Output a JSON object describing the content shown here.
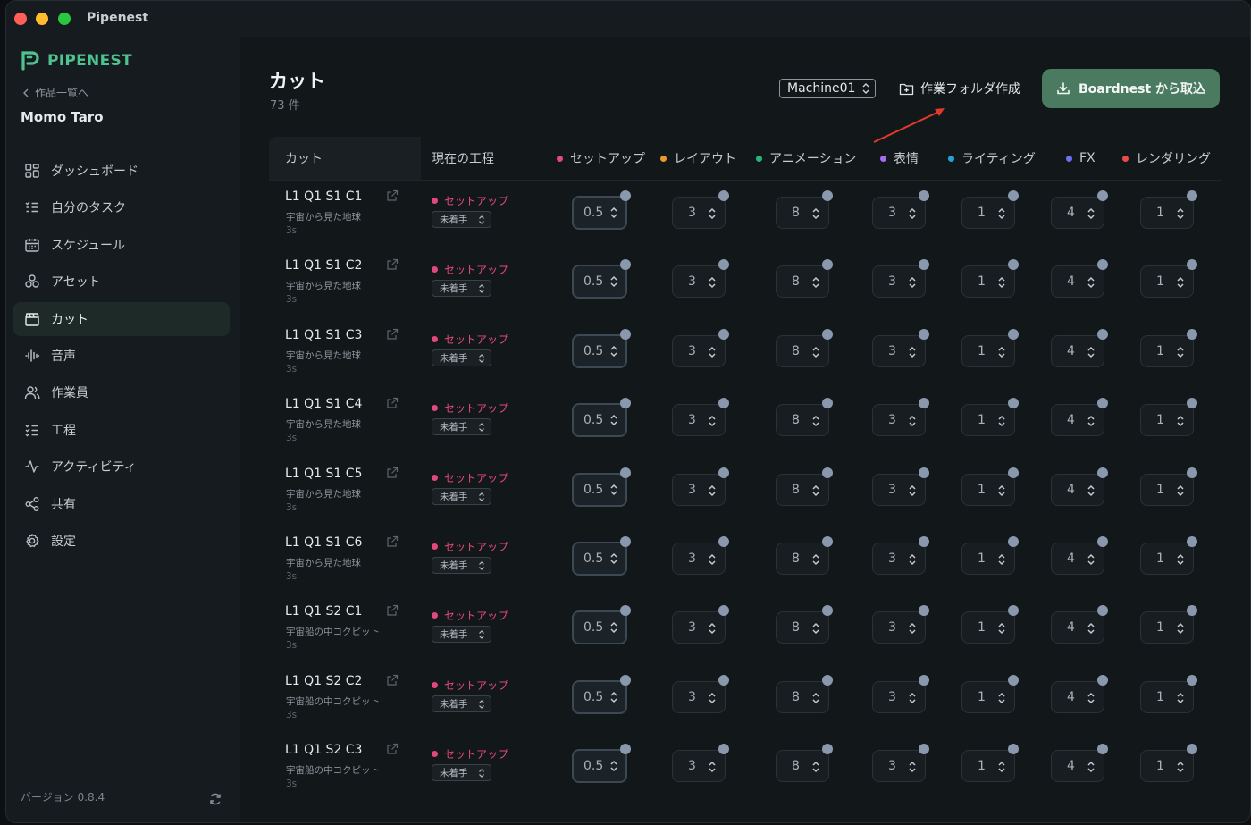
{
  "app": {
    "window_title": "Pipenest"
  },
  "sidebar": {
    "logo_text": "PIPENEST",
    "back_label": "作品一覧へ",
    "project_name": "Momo Taro",
    "items": [
      {
        "label": "ダッシュボード",
        "icon": "dashboard-icon",
        "active": false
      },
      {
        "label": "自分のタスク",
        "icon": "task-list-icon",
        "active": false
      },
      {
        "label": "スケジュール",
        "icon": "calendar-icon",
        "active": false
      },
      {
        "label": "アセット",
        "icon": "shapes-icon",
        "active": false
      },
      {
        "label": "カット",
        "icon": "clapperboard-icon",
        "active": true
      },
      {
        "label": "音声",
        "icon": "audio-waveform-icon",
        "active": false
      },
      {
        "label": "作業員",
        "icon": "users-icon",
        "active": false
      },
      {
        "label": "工程",
        "icon": "checklist-icon",
        "active": false
      },
      {
        "label": "アクティビティ",
        "icon": "activity-icon",
        "active": false
      },
      {
        "label": "共有",
        "icon": "share-icon",
        "active": false
      },
      {
        "label": "設定",
        "icon": "gear-icon",
        "active": false
      }
    ],
    "version": "バージョン 0.8.4"
  },
  "header": {
    "title": "カット",
    "count": "73 件",
    "machine_select": "Machine01",
    "folder_button": "作業フォルダ作成",
    "import_button": "Boardnest から取込"
  },
  "table": {
    "col_cut": "カット",
    "col_stage": "現在の工程",
    "processes": [
      {
        "label": "セットアップ",
        "color": "#e2497a"
      },
      {
        "label": "レイアウト",
        "color": "#e89a2c"
      },
      {
        "label": "アニメーション",
        "color": "#27b57a"
      },
      {
        "label": "表情",
        "color": "#a66bf0"
      },
      {
        "label": "ライティング",
        "color": "#24a3d6"
      },
      {
        "label": "FX",
        "color": "#6b72f0"
      },
      {
        "label": "レンダリング",
        "color": "#ec4b4b"
      }
    ],
    "rows": [
      {
        "name": "L1 Q1 S1 C1",
        "desc": "宇宙から見た地球",
        "duration": "3s",
        "stage": "セットアップ",
        "status": "未着手",
        "values": [
          "0.5",
          "3",
          "8",
          "3",
          "1",
          "4",
          "1"
        ]
      },
      {
        "name": "L1 Q1 S1 C2",
        "desc": "宇宙から見た地球",
        "duration": "3s",
        "stage": "セットアップ",
        "status": "未着手",
        "values": [
          "0.5",
          "3",
          "8",
          "3",
          "1",
          "4",
          "1"
        ]
      },
      {
        "name": "L1 Q1 S1 C3",
        "desc": "宇宙から見た地球",
        "duration": "3s",
        "stage": "セットアップ",
        "status": "未着手",
        "values": [
          "0.5",
          "3",
          "8",
          "3",
          "1",
          "4",
          "1"
        ]
      },
      {
        "name": "L1 Q1 S1 C4",
        "desc": "宇宙から見た地球",
        "duration": "3s",
        "stage": "セットアップ",
        "status": "未着手",
        "values": [
          "0.5",
          "3",
          "8",
          "3",
          "1",
          "4",
          "1"
        ]
      },
      {
        "name": "L1 Q1 S1 C5",
        "desc": "宇宙から見た地球",
        "duration": "3s",
        "stage": "セットアップ",
        "status": "未着手",
        "values": [
          "0.5",
          "3",
          "8",
          "3",
          "1",
          "4",
          "1"
        ]
      },
      {
        "name": "L1 Q1 S1 C6",
        "desc": "宇宙から見た地球",
        "duration": "3s",
        "stage": "セットアップ",
        "status": "未着手",
        "values": [
          "0.5",
          "3",
          "8",
          "3",
          "1",
          "4",
          "1"
        ]
      },
      {
        "name": "L1 Q1 S2 C1",
        "desc": "宇宙船の中コクピット",
        "duration": "3s",
        "stage": "セットアップ",
        "status": "未着手",
        "values": [
          "0.5",
          "3",
          "8",
          "3",
          "1",
          "4",
          "1"
        ]
      },
      {
        "name": "L1 Q1 S2 C2",
        "desc": "宇宙船の中コクピット",
        "duration": "3s",
        "stage": "セットアップ",
        "status": "未着手",
        "values": [
          "0.5",
          "3",
          "8",
          "3",
          "1",
          "4",
          "1"
        ]
      },
      {
        "name": "L1 Q1 S2 C3",
        "desc": "宇宙船の中コクピット",
        "duration": "3s",
        "stage": "セットアップ",
        "status": "未着手",
        "values": [
          "0.5",
          "3",
          "8",
          "3",
          "1",
          "4",
          "1"
        ]
      }
    ]
  }
}
